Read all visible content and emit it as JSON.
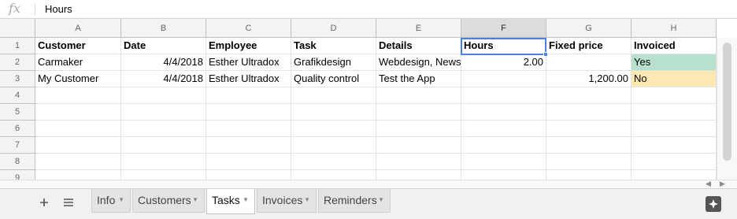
{
  "formula_bar": {
    "fx_label": "fx",
    "value": "Hours"
  },
  "columns": [
    "A",
    "B",
    "C",
    "D",
    "E",
    "F",
    "G",
    "H"
  ],
  "selected_column": "F",
  "selected_cell": "F1",
  "rows": [
    {
      "number": "1",
      "cells": [
        "Customer",
        "Date",
        "Employee",
        "Task",
        "Details",
        "Hours",
        "Fixed price",
        "Invoiced"
      ]
    },
    {
      "number": "2",
      "cells": [
        "Carmaker",
        "4/4/2018",
        "Esther Ultradox",
        "Grafikdesign",
        "Webdesign, News",
        "2.00",
        "",
        "Yes"
      ]
    },
    {
      "number": "3",
      "cells": [
        "My Customer",
        "4/4/2018",
        "Esther Ultradox",
        "Quality control",
        "Test the App",
        "",
        "1,200.00",
        "No"
      ]
    },
    {
      "number": "4",
      "cells": [
        "",
        "",
        "",
        "",
        "",
        "",
        "",
        ""
      ]
    },
    {
      "number": "5",
      "cells": [
        "",
        "",
        "",
        "",
        "",
        "",
        "",
        ""
      ]
    },
    {
      "number": "6",
      "cells": [
        "",
        "",
        "",
        "",
        "",
        "",
        "",
        ""
      ]
    },
    {
      "number": "7",
      "cells": [
        "",
        "",
        "",
        "",
        "",
        "",
        "",
        ""
      ]
    },
    {
      "number": "8",
      "cells": [
        "",
        "",
        "",
        "",
        "",
        "",
        "",
        ""
      ]
    },
    {
      "number": "9",
      "cells": [
        "",
        "",
        "",
        "",
        "",
        "",
        "",
        ""
      ]
    }
  ],
  "cell_fills": {
    "yes": "#b7e1cd",
    "no": "#fce8b2"
  },
  "accent_color": "#4a7ee0",
  "sheet_tabs": [
    {
      "label": "Info",
      "active": false
    },
    {
      "label": "Customers",
      "active": false
    },
    {
      "label": "Tasks",
      "active": true
    },
    {
      "label": "Invoices",
      "active": false
    },
    {
      "label": "Reminders",
      "active": false
    }
  ],
  "icons": {
    "add_sheet": "plus-icon",
    "all_sheets": "list-icon",
    "explore": "explore-icon",
    "tab_menu": "caret-down-icon"
  }
}
